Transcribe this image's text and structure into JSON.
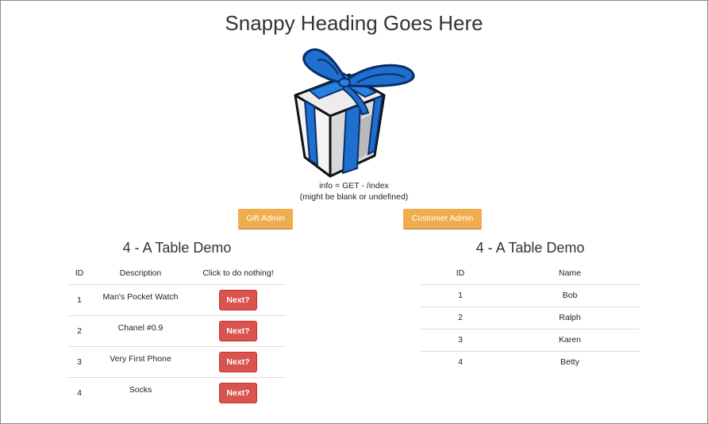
{
  "page": {
    "heading": "Snappy Heading Goes Here",
    "info_line1": "info = GET - /index",
    "info_line2": "(might be blank or undefined)"
  },
  "buttons": {
    "gift_admin": "Gift Admin",
    "customer_admin": "Customer Admin"
  },
  "gift_table": {
    "title": "4 - A Table Demo",
    "headers": [
      "ID",
      "Description",
      "Click to do nothing!"
    ],
    "rows": [
      {
        "id": "1",
        "description": "Man's Pocket Watch",
        "action": "Next?"
      },
      {
        "id": "2",
        "description": "Chanel #0.9",
        "action": "Next?"
      },
      {
        "id": "3",
        "description": "Very First Phone",
        "action": "Next?"
      },
      {
        "id": "4",
        "description": "Socks",
        "action": "Next?"
      }
    ]
  },
  "customer_table": {
    "title": "4 - A Table Demo",
    "headers": [
      "ID",
      "Name"
    ],
    "rows": [
      {
        "id": "1",
        "name": "Bob"
      },
      {
        "id": "2",
        "name": "Ralph"
      },
      {
        "id": "3",
        "name": "Karen"
      },
      {
        "id": "4",
        "name": "Betty"
      }
    ]
  },
  "colors": {
    "admin_button": "#f0ad4e",
    "next_button": "#d9534f",
    "gift_ribbon": "#1f6fd1"
  },
  "icons": {
    "gift": "gift-icon"
  }
}
